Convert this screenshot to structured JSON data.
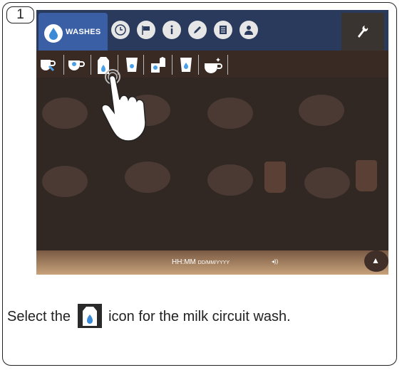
{
  "step": {
    "number": "1"
  },
  "topbar": {
    "washes_label": "WASHES",
    "icons": [
      "clock-icon",
      "flag-icon",
      "info-icon",
      "pencil-icon",
      "document-icon",
      "user-icon"
    ],
    "settings_icon": "wrench-icon"
  },
  "iconbar": {
    "tools": [
      "rinse-cups-icon",
      "cup-icon",
      "milk-circuit-icon",
      "water-glass-icon",
      "milk-jug-icon",
      "glass-drop-icon",
      "clean-spray-icon"
    ]
  },
  "status_bar": {
    "time": "HH:MM",
    "date": "DD/MM/YYYY",
    "volume": "◂))"
  },
  "caption": {
    "before": "Select the",
    "after": "icon for the milk circuit wash.",
    "icon": "milk-carton-icon"
  },
  "colors": {
    "topbar": "#2a3a5c",
    "active_tab": "#3a5fa4",
    "screen_bg": "#2c2420"
  }
}
